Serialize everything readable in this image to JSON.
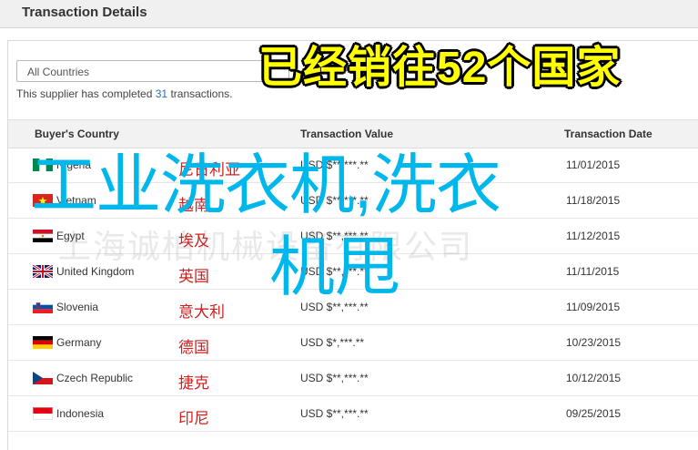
{
  "header": {
    "title": "Transaction Details"
  },
  "filter": {
    "selected": "All Countries"
  },
  "summary": {
    "prefix": "This supplier has completed ",
    "count": "31",
    "suffix": " transactions."
  },
  "table": {
    "headers": {
      "country": "Buyer's Country",
      "value": "Transaction Value",
      "date": "Transaction Date"
    },
    "rows": [
      {
        "country": "Nigeria",
        "flag": "nigeria-flag-icon",
        "value": "USD $**,***.**",
        "date": "11/01/2015",
        "overlay_cn": "尼日利亚"
      },
      {
        "country": "Vietnam",
        "flag": "vietnam-flag-icon",
        "value": "USD $**,***.**",
        "date": "11/18/2015",
        "overlay_cn": "越南"
      },
      {
        "country": "Egypt",
        "flag": "egypt-flag-icon",
        "value": "USD $**,***.**",
        "date": "11/12/2015",
        "overlay_cn": "埃及"
      },
      {
        "country": "United Kingdom",
        "flag": "uk-flag-icon",
        "value": "USD $**,***.**",
        "date": "11/11/2015",
        "overlay_cn": "英国"
      },
      {
        "country": "Slovenia",
        "flag": "slovenia-flag-icon",
        "value": "USD $**,***.**",
        "date": "11/09/2015",
        "overlay_cn": "意大利"
      },
      {
        "country": "Germany",
        "flag": "germany-flag-icon",
        "value": "USD $*,***.**",
        "date": "10/23/2015",
        "overlay_cn": "德国"
      },
      {
        "country": "Czech Republic",
        "flag": "czech-flag-icon",
        "value": "USD $**,***.**",
        "date": "10/12/2015",
        "overlay_cn": "捷克"
      },
      {
        "country": "Indonesia",
        "flag": "indonesia-flag-icon",
        "value": "USD $**,***.**",
        "date": "09/25/2015",
        "overlay_cn": "印尼"
      }
    ]
  },
  "overlay": {
    "banner": "已经销往52个国家",
    "product_line1": "工业洗衣机,洗衣",
    "product_line2": "机甩",
    "watermark": "上海诚柏机械设备有限公司"
  },
  "colors": {
    "banner_text": "#ffff00",
    "product_text": "#00b7ec",
    "country_cn_text": "#d41f1f",
    "count_link": "#2a6fb4"
  }
}
